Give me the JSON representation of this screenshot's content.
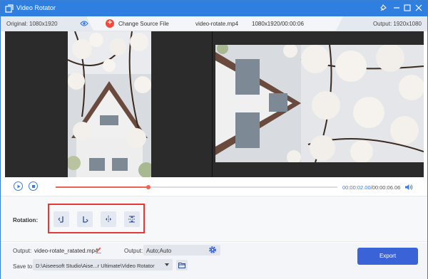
{
  "window": {
    "title": "Video Rotator"
  },
  "infobar": {
    "original_label": "Original: 1080x1920",
    "change_source_label": "Change Source File",
    "file_name": "video-rotate.mp4",
    "resolution_duration": "1080x1920/00:00:06",
    "output_label": "Output:  1920x1080"
  },
  "playback": {
    "current_time": "00:00:02.00",
    "total_time": "/00:00:06.06",
    "progress_fraction": 0.33
  },
  "rotation": {
    "label": "Rotation:",
    "buttons": [
      {
        "name": "rotate-left",
        "icon": "rotate-left-icon"
      },
      {
        "name": "rotate-right",
        "icon": "rotate-right-icon"
      },
      {
        "name": "flip-horizontal",
        "icon": "flip-horizontal-icon"
      },
      {
        "name": "flip-vertical",
        "icon": "flip-vertical-icon"
      }
    ]
  },
  "output": {
    "label": "Output:",
    "file_name": "video-rotate_ratated.mp4",
    "format_label": "Output:",
    "format_value": "Auto;Auto"
  },
  "save": {
    "label": "Save to:",
    "path": "D:\\Aiseesoft Studio\\Aise...r Ultimate\\Video Rotator"
  },
  "export_label": "Export",
  "colors": {
    "titlebar": "#2f7fe0",
    "accent": "#3b7ce2",
    "progress": "#f06250",
    "export": "#3a63d8",
    "highlight": "#e53935"
  }
}
